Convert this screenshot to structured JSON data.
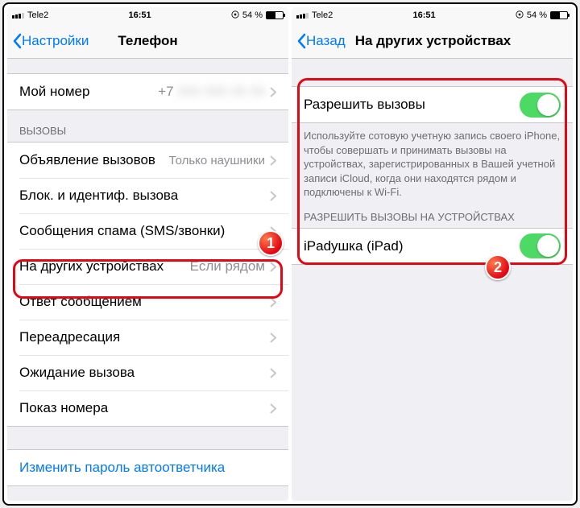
{
  "status": {
    "carrier": "Tele2",
    "time": "16:51",
    "battery_pct": "54 %"
  },
  "left": {
    "nav_back": "Настройки",
    "nav_title": "Телефон",
    "my_number_label": "Мой номер",
    "my_number_value": "+7",
    "calls_header": "ВЫЗОВЫ",
    "rows": {
      "announce": {
        "label": "Объявление вызовов",
        "value": "Только наушники"
      },
      "block": {
        "label": "Блок. и идентиф. вызова"
      },
      "spam": {
        "label": "Сообщения спама (SMS/звонки)"
      },
      "other_devices": {
        "label": "На других устройствах",
        "value": "Если рядом"
      },
      "respond": {
        "label": "Ответ сообщением"
      },
      "forward": {
        "label": "Переадресация"
      },
      "waiting": {
        "label": "Ожидание вызова"
      },
      "caller_id": {
        "label": "Показ номера"
      }
    },
    "change_voicemail": "Изменить пароль автоответчика"
  },
  "right": {
    "nav_back": "Назад",
    "nav_title": "На других устройствах",
    "allow_calls_label": "Разрешить вызовы",
    "footer": "Используйте сотовую учетную запись своего iPhone, чтобы совершать и принимать вызовы на устройствах, зарегистрированных в Вашей учетной записи iCloud, когда они находятся рядом и подключены к Wi-Fi.",
    "devices_header": "РАЗРЕШИТЬ ВЫЗОВЫ НА УСТРОЙСТВАХ",
    "device1_label": "iPadушка (iPad)"
  },
  "badges": {
    "one": "1",
    "two": "2"
  }
}
